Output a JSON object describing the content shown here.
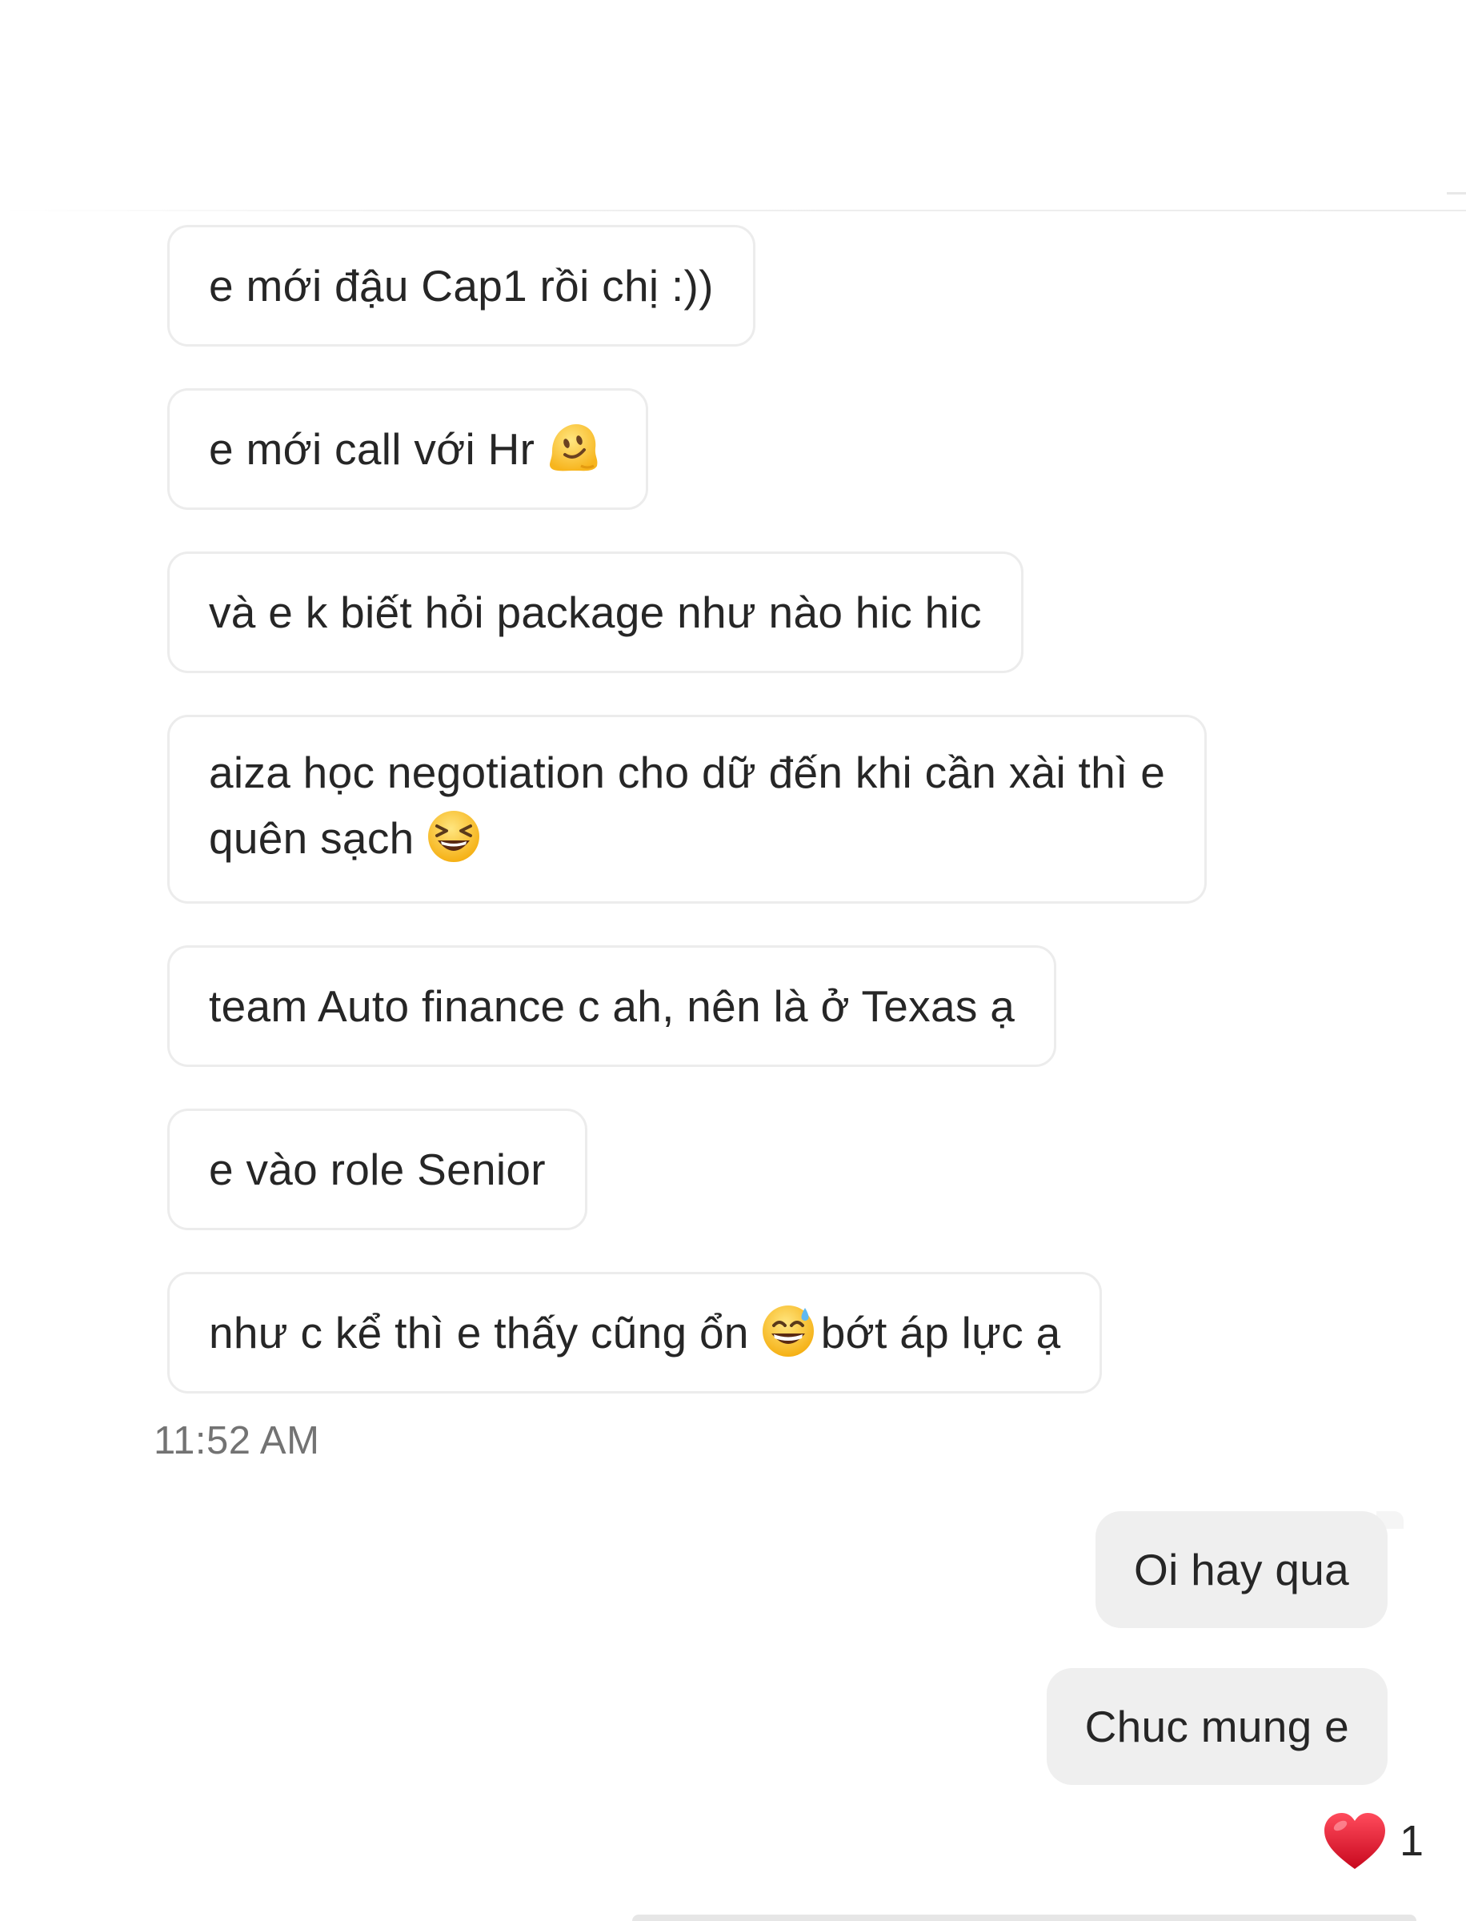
{
  "conversation": {
    "incoming": [
      {
        "text": "e mới đậu Cap1 rồi chị :))",
        "emoji": null,
        "text_after": ""
      },
      {
        "text": "e mới call với Hr",
        "emoji": "melting-face-emoji",
        "text_after": ""
      },
      {
        "text": "và e k biết hỏi package như nào hic hic",
        "emoji": null,
        "text_after": ""
      },
      {
        "line1": "aiza học negotiation cho dữ đến khi cần xài thì e",
        "line2": "quên sạch",
        "emoji": "laughing-squinting-face-emoji"
      },
      {
        "text": "team Auto finance c ah, nên là ở Texas ạ",
        "emoji": null,
        "text_after": ""
      },
      {
        "text": "e vào role Senior",
        "emoji": null,
        "text_after": ""
      },
      {
        "text": "như c kể thì e thấy cũng ổn",
        "emoji": "grinning-face-with-sweat-emoji",
        "text_after": "bớt áp lực ạ"
      }
    ],
    "timestamp": "11:52 AM",
    "outgoing": [
      {
        "text": "Oi hay qua"
      },
      {
        "text": "Chuc mung e"
      }
    ],
    "reaction": {
      "icon": "red-heart-emoji",
      "count": "1"
    }
  },
  "colors": {
    "incoming_bubble_bg": "#ffffff",
    "incoming_bubble_border": "#ececec",
    "outgoing_bubble_bg": "#efefef",
    "text": "#262626",
    "timestamp": "#737373",
    "heart": "#e0152b",
    "emoji_yellow": "#ffcc33"
  }
}
